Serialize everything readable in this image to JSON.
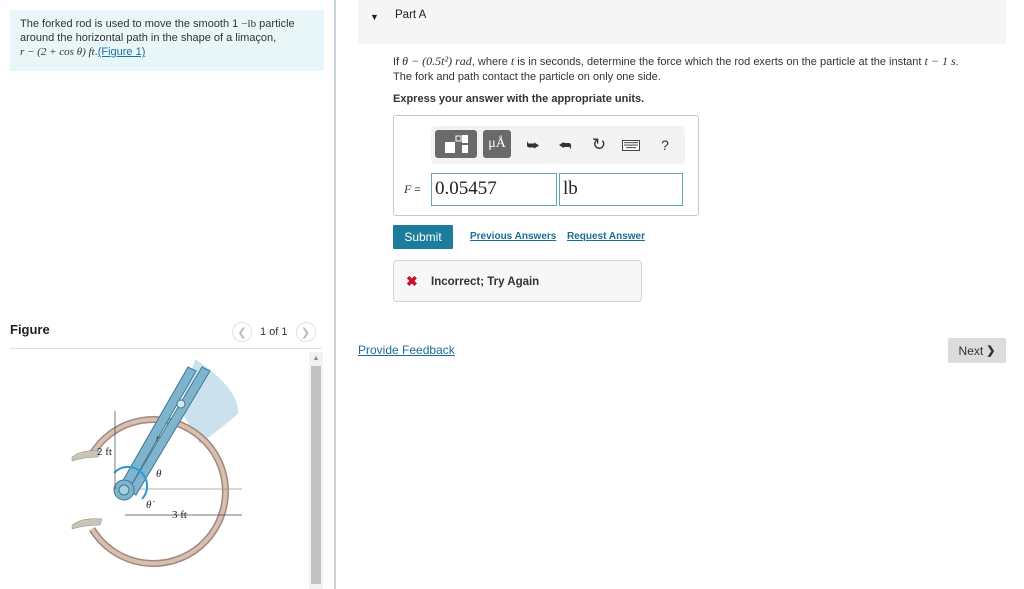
{
  "problem": {
    "text_before": "The forked rod is used to move the smooth 1",
    "unit_lb": "−lb",
    "text_middle": " particle around the horizontal path in the shape of a limaçon, ",
    "equation": "r − (2 + cos θ) ft",
    "period": ".",
    "figure_link": "(Figure 1)"
  },
  "figure": {
    "title": "Figure",
    "pager": "1 of 1",
    "prev_icon": "chevron-left-icon",
    "next_icon": "chevron-right-icon",
    "labels": {
      "dim_vertical": "2 ft",
      "dim_horizontal": "3 ft",
      "theta": "θ",
      "theta_dot": "θ̇",
      "r": "r"
    }
  },
  "part": {
    "title": "Part A",
    "question_line1_a": "If ",
    "question_theta_eq": "θ − (0.5t²) rad",
    "question_line1_b": ", where ",
    "question_t": "t",
    "question_line1_c": " is in seconds, determine the force which the rod exerts on the particle at the instant ",
    "question_t_eq": "t − 1 s",
    "question_line1_d": ".",
    "question_line2": "The fork and path contact the particle on only one side.",
    "instruction": "Express your answer with the appropriate units."
  },
  "answer": {
    "toolbar": {
      "templates_icon": "templates-icon",
      "units_label": "μÅ",
      "undo_icon": "undo-icon",
      "redo_icon": "redo-icon",
      "reset_icon": "reset-icon",
      "keyboard_icon": "keyboard-icon",
      "help_label": "?"
    },
    "variable": "F",
    "equals": " =",
    "value": "0.05457",
    "unit": "lb"
  },
  "actions": {
    "submit": "Submit",
    "previous_answers": "Previous Answers",
    "request_answer": "Request Answer"
  },
  "result": {
    "icon": "✖",
    "text": "Incorrect; Try Again"
  },
  "footer": {
    "feedback": "Provide Feedback",
    "next": "Next",
    "next_icon": "❯"
  }
}
